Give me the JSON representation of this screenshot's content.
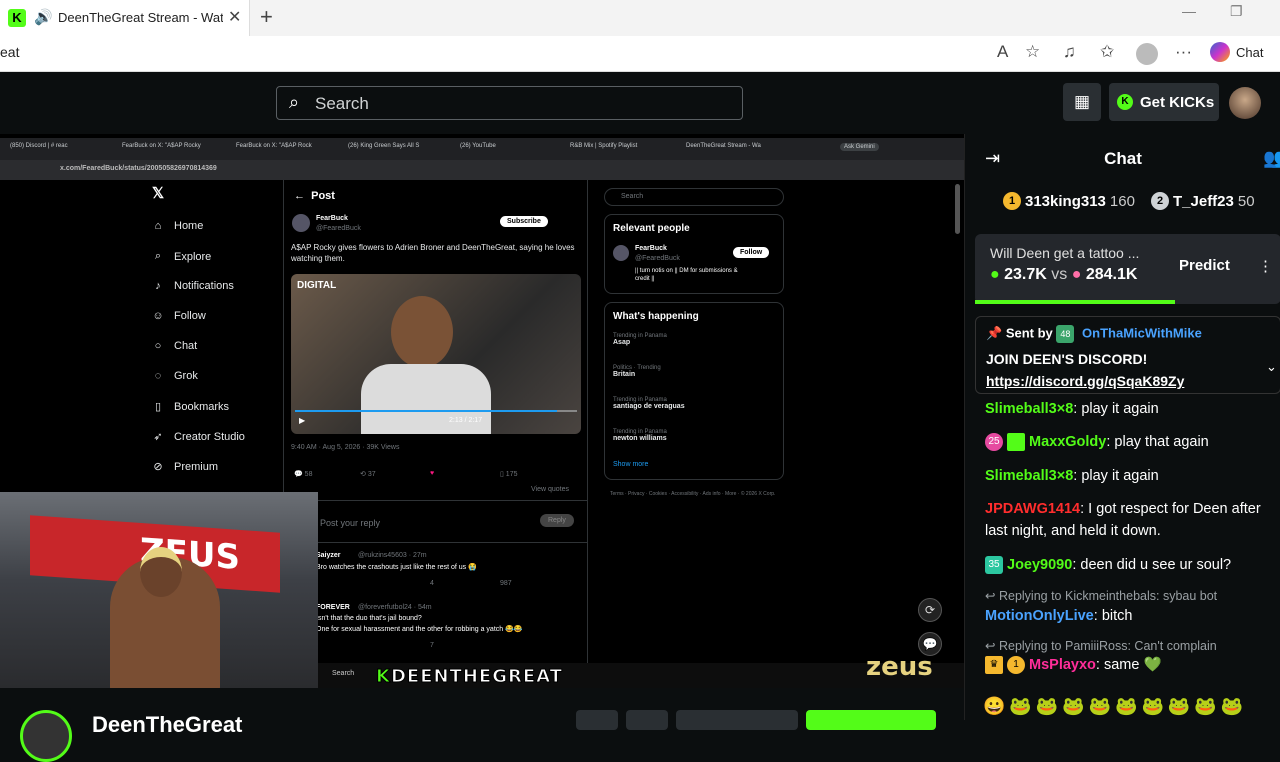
{
  "browser": {
    "tab_title": "DeenTheGreat Stream - Watch",
    "url_fragment": "eat",
    "copilot_label": "Chat"
  },
  "header": {
    "search_placeholder": "Search",
    "get_kicks_label": "Get KICKs"
  },
  "inner": {
    "tabs": [
      "(850) Discord | # reac",
      "FearBuck on X: \"A$AP Rocky",
      "FearBuck on X: \"A$AP Rock",
      "(26) King Green Says All S",
      "(26) YouTube",
      "R&B Mix | Spotify Playlist",
      "DeenTheGreat Stream - Wa",
      "Ask Gemini"
    ],
    "url": "x.com/FearedBuck/status/200505826970814369",
    "nav": [
      "Home",
      "Explore",
      "Notifications",
      "Follow",
      "Chat",
      "Grok",
      "Bookmarks",
      "Creator Studio",
      "Premium"
    ],
    "post_header": "Post",
    "author": "FearBuck",
    "handle": "@FearedBuck",
    "subscribe": "Subscribe",
    "post_text": "A$AP Rocky gives flowers to Adrien Broner and DeenTheGreat, saying he loves watching them.",
    "video_tag": "DIGITAL",
    "video_time": "2:13 / 2:17",
    "post_meta": "9:40 AM · Aug 5, 2026 · 39K Views",
    "actions": [
      "58",
      "37",
      "",
      "175"
    ],
    "view_quotes": "View quotes",
    "reply_placeholder": "Post your reply",
    "reply_btn": "Reply",
    "replies": [
      {
        "name": "Saiyzer",
        "handle": "@rukzins45603 · 27m",
        "text": "Bro watches the crashouts just like the rest of us 😭",
        "stats": [
          "",
          "",
          "4",
          "987"
        ]
      },
      {
        "name": "FOREVER",
        "handle": "@foreverfutbol24 · 54m",
        "text": "Isn't that the duo that's jail bound?",
        "text2": "One for sexual harassment and the other for robbing a yatch 😂😂",
        "stats": [
          "",
          "",
          "7",
          ""
        ]
      }
    ],
    "right": {
      "search": "Search",
      "relevant": "Relevant people",
      "rp_name": "FearBuck",
      "rp_handle": "@FearedBuck",
      "rp_bio": "|| turn notis on || DM for submissions & credit ||",
      "follow": "Follow",
      "happening": "What's happening",
      "trends": [
        {
          "a": "Trending in Panama",
          "b": "Asap"
        },
        {
          "a": "Politics · Trending",
          "b": "Britain"
        },
        {
          "a": "Trending in Panama",
          "b": "santiago de veraguas"
        },
        {
          "a": "Trending in Panama",
          "b": "newton williams"
        }
      ],
      "show_more": "Show more",
      "footer": "Terms · Privacy · Cookies · Accessibility · Ads info · More · © 2026 X Corp."
    },
    "kickbar_brand": "DEENTHEGREAT",
    "kickbar_search": "Search"
  },
  "chat": {
    "title": "Chat",
    "leaders": [
      {
        "rank": "1",
        "name": "313king313",
        "count": "160"
      },
      {
        "rank": "2",
        "name": "T_Jeff23",
        "count": "50"
      }
    ],
    "prediction": {
      "question": "Will Deen get a tattoo ...",
      "a": "23.7K",
      "vs": "vs",
      "b": "284.1K",
      "button": "Predict"
    },
    "pinned": {
      "sent_by": "Sent by",
      "sender": "OnThaMicWithMike",
      "badge": "48",
      "message": "JOIN DEEN'S DISCORD!",
      "link": "https://discord.gg/qSqaK89Zy"
    },
    "messages": [
      {
        "user": "Slimeball3×8",
        "text": "play it again",
        "color": "#53fc18"
      },
      {
        "user": "MaxxGoldy",
        "text": "play that again",
        "color": "#53fc18",
        "badge": "25"
      },
      {
        "user": "Slimeball3×8",
        "text": "play it again",
        "color": "#53fc18"
      },
      {
        "user": "JPDAWG1414",
        "text": "I got respect for Deen after last night, and held it down.",
        "color": "#ff2d2d"
      },
      {
        "user": "Joey9090",
        "text": "deen did u see ur soul?",
        "color": "#53fc18",
        "badge": "35"
      },
      {
        "reply": "Replying to Kickmeinthebals: sybau bot",
        "user": "MotionOnlyLive",
        "text": "bitch",
        "color": "#4aa3ff"
      },
      {
        "reply": "Replying to PamiiiRoss: Can't complain",
        "user": "MsPlayxo",
        "text": "same 💚",
        "color": "#ff2d9a",
        "badge": "1"
      }
    ],
    "emotes": "😀🐸🐸🐸🐸🐸🐸🐸🐸🐸"
  },
  "channel": {
    "name": "DeenTheGreat"
  }
}
